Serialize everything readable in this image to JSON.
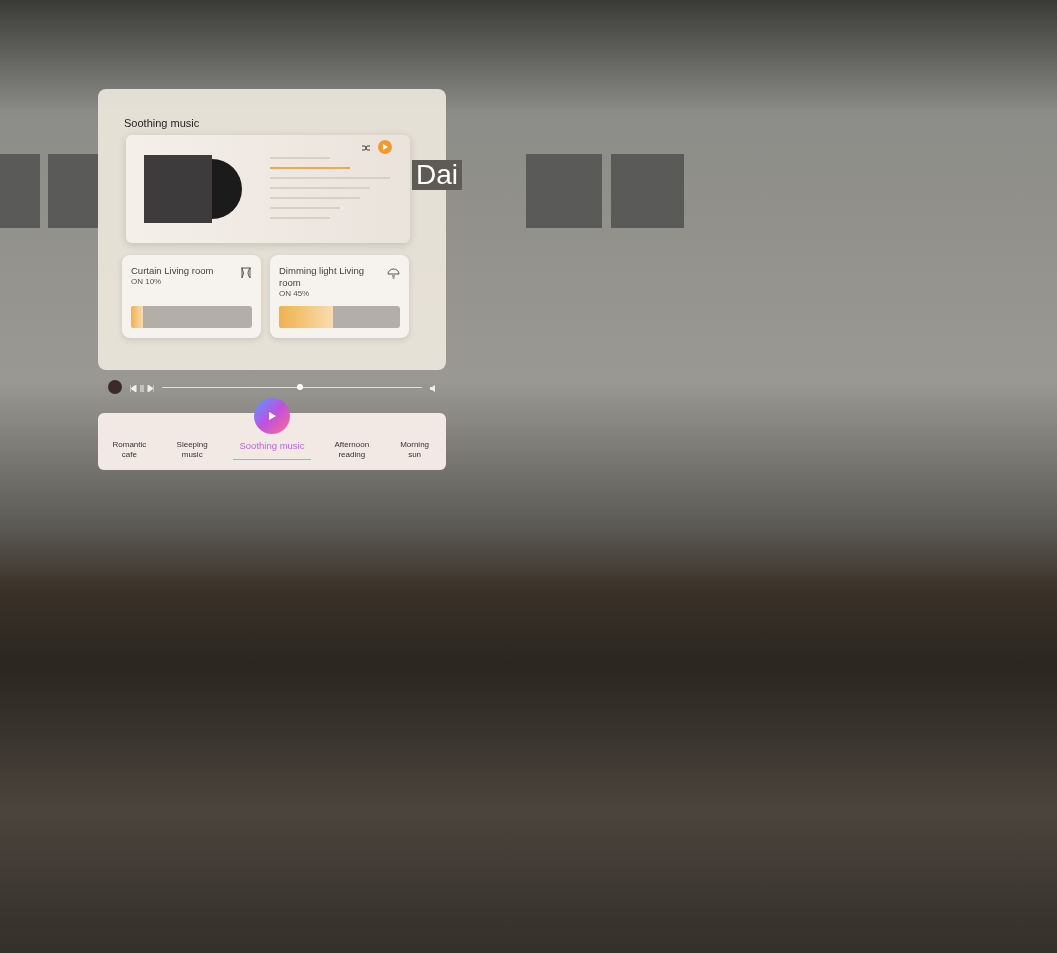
{
  "background_title": "Dai",
  "panel": {
    "title": "Soothing music"
  },
  "devices": [
    {
      "kind": "curtain",
      "name": "Curtain Living room",
      "status": "ON 10%",
      "level": 0.1
    },
    {
      "kind": "light",
      "name": "Dimming light Living room",
      "status": "ON 45%",
      "level": 0.45
    }
  ],
  "player": {
    "level": 0.53
  },
  "scenes": [
    {
      "label": "Romantic cafe",
      "selected": false
    },
    {
      "label": "Sleeping music",
      "selected": false
    },
    {
      "label": "Soothing music",
      "selected": true
    },
    {
      "label": "Afternoon reading",
      "selected": false
    },
    {
      "label": "Morning sun",
      "selected": false
    }
  ]
}
